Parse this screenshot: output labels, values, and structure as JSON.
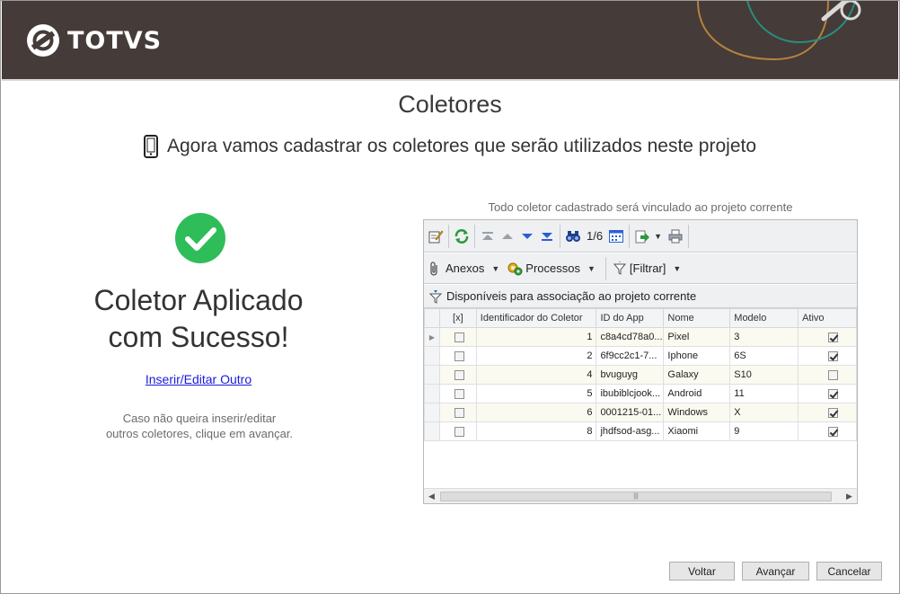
{
  "header": {
    "brand": "TOTVS",
    "logo_icon": "totvs-logo-icon",
    "background": "#453b38"
  },
  "page": {
    "title": "Coletores",
    "subtitle": "Agora vamos cadastrar os coletores que serão utilizados neste projeto",
    "subtitle_icon": "mobile-phone-icon"
  },
  "success": {
    "icon": "check-circle-icon",
    "icon_color": "#2ebd59",
    "title_line1": "Coletor Aplicado",
    "title_line2": "com Sucesso!",
    "link": "Inserir/Editar Outro",
    "hint": "Caso não queira inserir/editar outros coletores, clique em avançar."
  },
  "grid": {
    "caption": "Todo coletor cadastrado será vinculado ao projeto corrente",
    "page_indicator": "1/6",
    "menus": {
      "anexos": "Anexos",
      "processos": "Processos",
      "filtrar": "[Filtrar]"
    },
    "assoc_label": "Disponíveis para associação ao projeto corrente",
    "columns": [
      "[x]",
      "Identificador do Coletor",
      "ID do App",
      "Nome",
      "Modelo",
      "Ativo"
    ],
    "rows": [
      {
        "selected": false,
        "id": "1",
        "app_id": "c8a4cd78a0...",
        "name": "Pixel",
        "model": "3",
        "active": true,
        "current": true
      },
      {
        "selected": false,
        "id": "2",
        "app_id": "6f9cc2c1-7...",
        "name": "Iphone",
        "model": "6S",
        "active": true,
        "current": false
      },
      {
        "selected": false,
        "id": "4",
        "app_id": "bvuguyg",
        "name": "Galaxy",
        "model": "S10",
        "active": false,
        "current": false
      },
      {
        "selected": false,
        "id": "5",
        "app_id": "ibubiblcjook...",
        "name": "Android",
        "model": "11",
        "active": true,
        "current": false
      },
      {
        "selected": false,
        "id": "6",
        "app_id": "0001215-01...",
        "name": "Windows",
        "model": "X",
        "active": true,
        "current": false
      },
      {
        "selected": false,
        "id": "8",
        "app_id": "jhdfsod-asg...",
        "name": "Xiaomi",
        "model": "9",
        "active": true,
        "current": false
      }
    ]
  },
  "footer": {
    "back": "Voltar",
    "next": "Avançar",
    "cancel": "Cancelar"
  }
}
